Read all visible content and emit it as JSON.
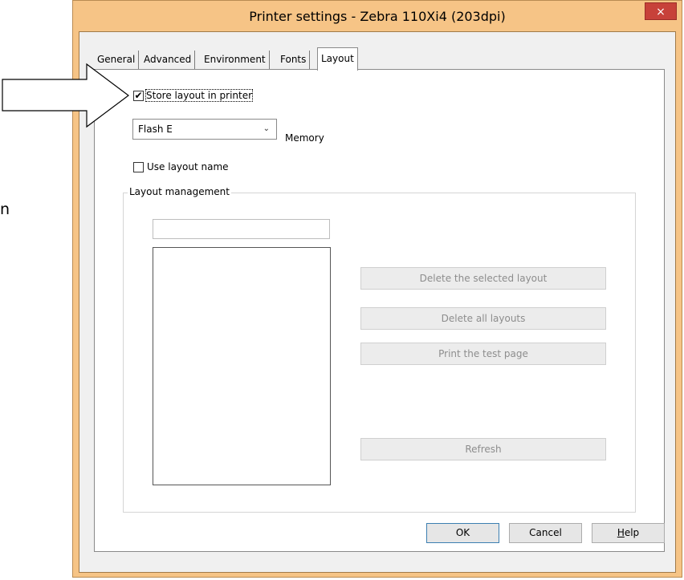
{
  "side_text": "n",
  "window": {
    "title": "Printer settings - Zebra 110Xi4 (203dpi)",
    "close_glyph": "×"
  },
  "tabs": [
    {
      "label": "General"
    },
    {
      "label": "Advanced"
    },
    {
      "label": "Environment"
    },
    {
      "label": "Fonts"
    },
    {
      "label": "Layout",
      "active": true
    }
  ],
  "layout_tab": {
    "store_layout": {
      "label": "Store layout in printer",
      "checked": true,
      "check_glyph": "✔"
    },
    "memory_select": {
      "value": "Flash E",
      "chevron": "⌄"
    },
    "memory_label": "Memory",
    "use_layout_name": {
      "label": "Use layout name",
      "checked": false
    },
    "layout_management": {
      "title": "Layout management",
      "name_field_value": "",
      "layout_list_items": [],
      "buttons": {
        "delete_selected": "Delete the selected layout",
        "delete_all": "Delete all layouts",
        "print_test": "Print the test page",
        "refresh": "Refresh"
      }
    }
  },
  "footer": {
    "ok": "OK",
    "cancel": "Cancel",
    "help": "Help"
  },
  "colors": {
    "title_bar": "#f6c486",
    "close_button": "#c7413a",
    "dialog_background": "#f0f0f0",
    "disabled_button_text": "#8d8d8d"
  }
}
